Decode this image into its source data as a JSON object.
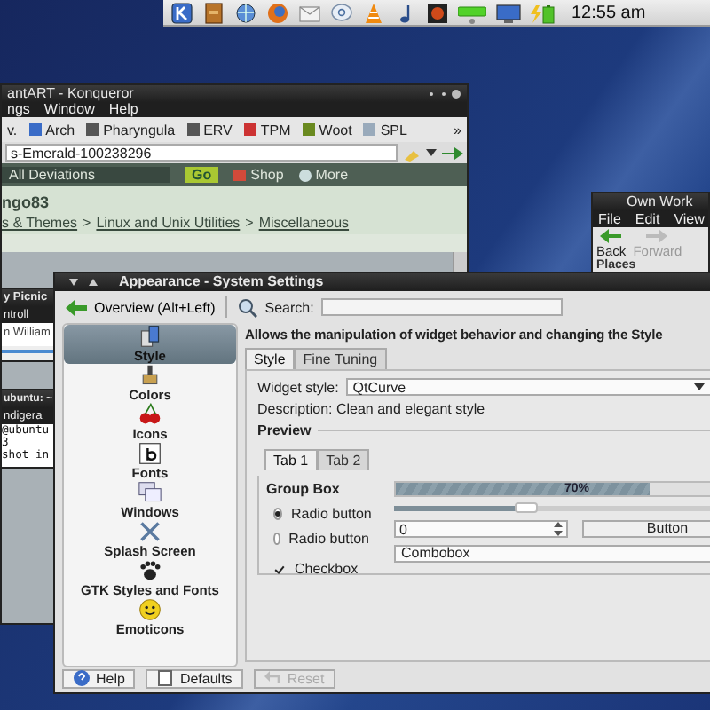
{
  "panel": {
    "clock": "12:55 am"
  },
  "browser_window": {
    "title": "antART - Konqueror",
    "menu": [
      "ngs",
      "Window",
      "Help"
    ],
    "bookmarks": [
      "v.",
      "Arch",
      "Pharyngula",
      "ERV",
      "TPM",
      "Woot",
      "SPL"
    ],
    "more_bookmarks": "»",
    "url": "s-Emerald-100238296",
    "site_bar": {
      "scope": "All Deviations",
      "go": "Go",
      "links": [
        "Shop",
        "More"
      ]
    },
    "user": "ngo83",
    "breadcrumb": [
      "s & Themes",
      "Linux and Unix Utilities",
      "Miscellaneous"
    ],
    "separators": [
      ">",
      ">"
    ]
  },
  "chat_window": {
    "title": "y Picnic",
    "menu": [
      "ntroll"
    ],
    "line": "n William"
  },
  "terminal_window": {
    "title": "ubuntu: ~",
    "menu": [
      "ndigera"
    ],
    "lines": [
      "@ubuntu",
      "3",
      "shot in"
    ]
  },
  "file_manager": {
    "title": "Own Work",
    "menu": [
      "File",
      "Edit",
      "View"
    ],
    "toolbar": [
      {
        "label": "Back",
        "disabled": false
      },
      {
        "label": "Forward",
        "disabled": true
      }
    ],
    "places": "Places"
  },
  "settings_window": {
    "title": "Appearance - System Settings",
    "overview": "Overview (Alt+Left)",
    "search_label": "Search:",
    "categories": [
      {
        "label": "Style",
        "selected": true
      },
      {
        "label": "Colors",
        "selected": false
      },
      {
        "label": "Icons",
        "selected": false
      },
      {
        "label": "Fonts",
        "selected": false
      },
      {
        "label": "Windows",
        "selected": false
      },
      {
        "label": "Splash Screen",
        "selected": false
      },
      {
        "label": "GTK Styles and Fonts",
        "selected": false
      },
      {
        "label": "Emoticons",
        "selected": false
      }
    ],
    "header": "Allows the manipulation of widget behavior and changing the Style",
    "tabs": [
      {
        "label": "Style",
        "selected": true
      },
      {
        "label": "Fine Tuning",
        "selected": false
      }
    ],
    "widget_style": {
      "label": "Widget style:",
      "value": "QtCurve"
    },
    "style_description": "Description: Clean and elegant style",
    "preview": {
      "title": "Preview",
      "tabs": [
        {
          "label": "Tab 1",
          "selected": true
        },
        {
          "label": "Tab 2",
          "selected": false
        }
      ],
      "group_title": "Group Box",
      "radios": [
        {
          "label": "Radio button",
          "selected": true
        },
        {
          "label": "Radio button",
          "selected": false
        }
      ],
      "checkbox": {
        "label": "Checkbox",
        "checked": true
      },
      "progress": {
        "level": 0.7,
        "reading": "70%"
      },
      "slider": {
        "level": 0.36
      },
      "spinbox": "0",
      "button": "Button",
      "combobox": "Combobox"
    },
    "buttons": [
      {
        "label": "Help",
        "disabled": false
      },
      {
        "label": "Defaults",
        "disabled": false
      },
      {
        "label": "Reset",
        "disabled": true
      }
    ]
  }
}
